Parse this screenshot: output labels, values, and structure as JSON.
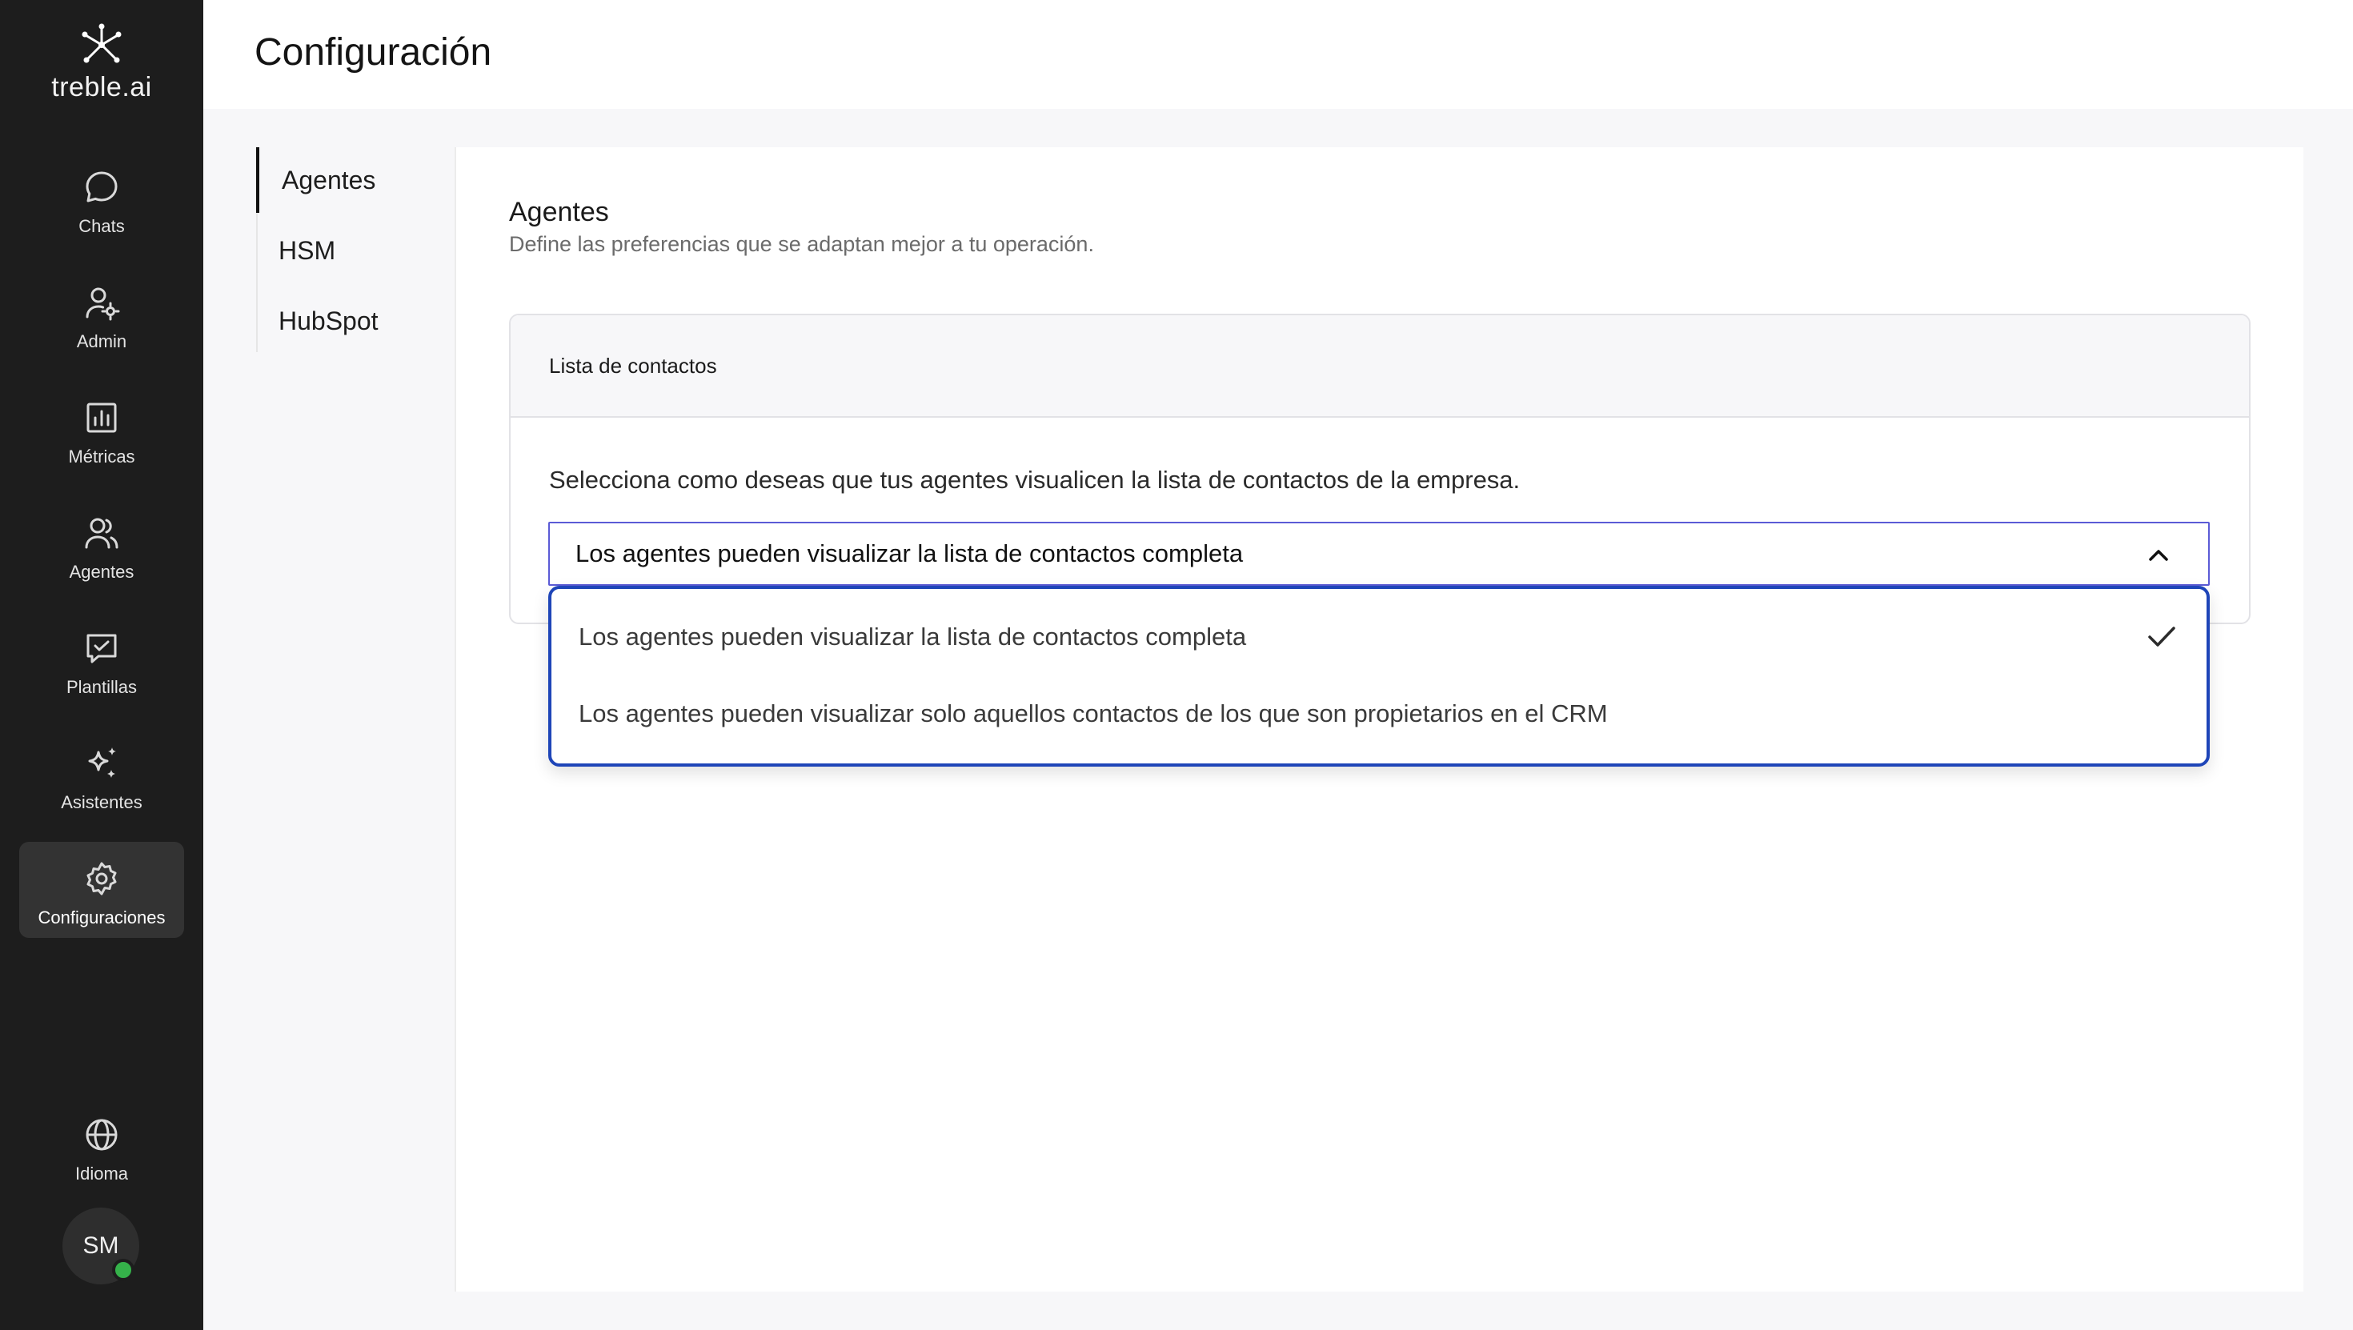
{
  "brand": {
    "name": "treble.ai"
  },
  "sidebar": {
    "items": [
      {
        "label": "Chats",
        "icon": "chat-bubble-icon"
      },
      {
        "label": "Admin",
        "icon": "user-gear-icon"
      },
      {
        "label": "Métricas",
        "icon": "bar-chart-icon"
      },
      {
        "label": "Agentes",
        "icon": "users-icon"
      },
      {
        "label": "Plantillas",
        "icon": "template-check-icon"
      },
      {
        "label": "Asistentes",
        "icon": "sparkles-icon"
      },
      {
        "label": "Configuraciones",
        "icon": "gear-icon",
        "active": true
      }
    ],
    "language": {
      "label": "Idioma",
      "icon": "globe-icon"
    },
    "user": {
      "initials": "SM",
      "status": "online",
      "status_color": "#35b24a"
    }
  },
  "header": {
    "title": "Configuración"
  },
  "subnav": {
    "items": [
      {
        "label": "Agentes",
        "active": true
      },
      {
        "label": "HSM"
      },
      {
        "label": "HubSpot"
      }
    ]
  },
  "main": {
    "section_title": "Agentes",
    "section_subtitle": "Define las preferencias que se adaptan mejor a tu operación.",
    "card": {
      "title": "Lista de contactos",
      "description": "Selecciona como deseas que tus agentes visualicen la lista de contactos de la empresa.",
      "select": {
        "value": "Los agentes pueden visualizar la lista de contactos completa",
        "expanded": true,
        "options": [
          {
            "label": "Los agentes pueden visualizar la lista de contactos completa",
            "selected": true
          },
          {
            "label": "Los agentes pueden visualizar solo aquellos contactos de los que son propietarios en el CRM",
            "selected": false
          }
        ]
      }
    }
  },
  "colors": {
    "sidebar_bg": "#1d1d1d",
    "active_nav_bg": "#333333",
    "dropdown_border": "#1e45b8",
    "select_border": "#5b5bd6",
    "online": "#35b24a"
  }
}
